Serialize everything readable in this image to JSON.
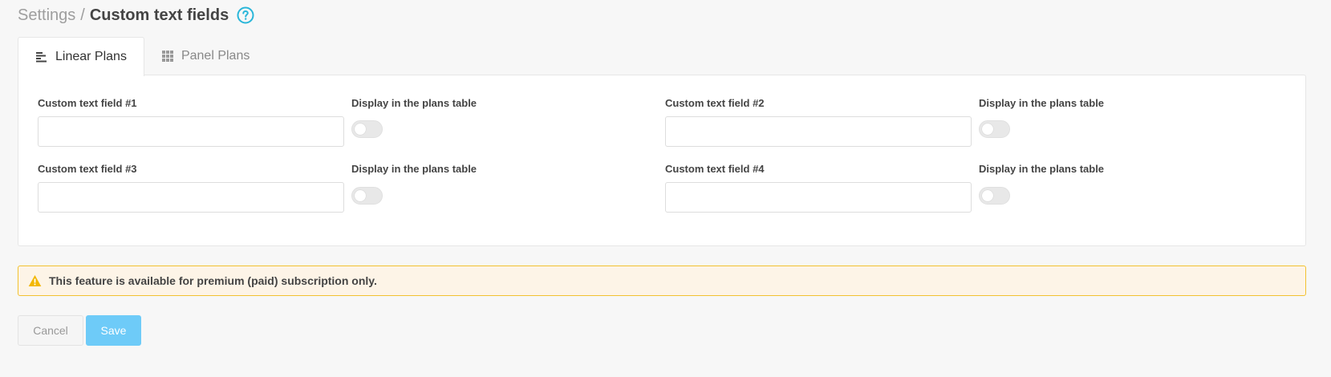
{
  "breadcrumb": {
    "root": "Settings",
    "separator": "/",
    "current": "Custom text fields"
  },
  "help_icon": "question-circle-icon",
  "tabs": [
    {
      "label": "Linear Plans",
      "icon": "align-left-icon",
      "active": true
    },
    {
      "label": "Panel Plans",
      "icon": "grid-icon",
      "active": false
    }
  ],
  "fields": [
    {
      "label": "Custom text field #1",
      "value": "",
      "toggle_label": "Display in the plans table",
      "toggle_on": false
    },
    {
      "label": "Custom text field #2",
      "value": "",
      "toggle_label": "Display in the plans table",
      "toggle_on": false
    },
    {
      "label": "Custom text field #3",
      "value": "",
      "toggle_label": "Display in the plans table",
      "toggle_on": false
    },
    {
      "label": "Custom text field #4",
      "value": "",
      "toggle_label": "Display in the plans table",
      "toggle_on": false
    }
  ],
  "alert": {
    "icon": "warning-triangle-icon",
    "text": "This feature is available for premium (paid) subscription only."
  },
  "buttons": {
    "cancel": "Cancel",
    "save": "Save"
  },
  "colors": {
    "accent": "#29b6d9",
    "save_button": "#6ecbf8",
    "warning": "#f2b705",
    "alert_bg": "#fdf4e7"
  }
}
